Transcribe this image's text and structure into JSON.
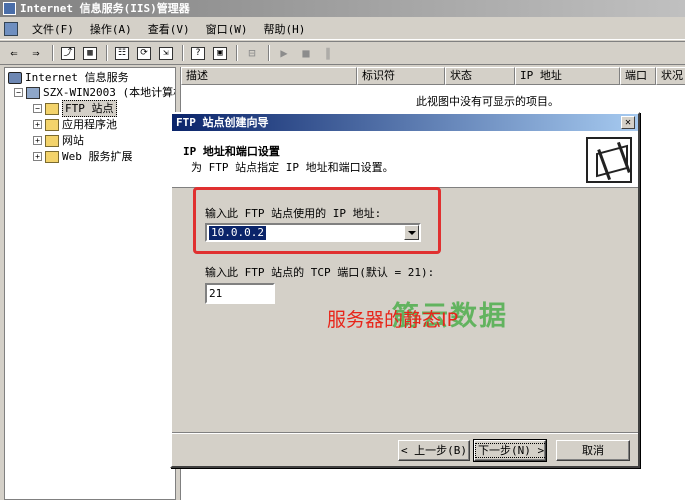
{
  "window": {
    "title": "Internet 信息服务(IIS)管理器"
  },
  "menu": [
    "文件(F)",
    "操作(A)",
    "查看(V)",
    "窗口(W)",
    "帮助(H)"
  ],
  "toolbar": {
    "icons": [
      "back-arrow-icon",
      "forward-arrow-icon",
      "up-folder-icon",
      "show-tree-icon",
      "properties-icon",
      "refresh-icon",
      "export-icon",
      "help-icon",
      "console-icon",
      "computer-icon",
      "play-icon",
      "stop-icon",
      "pause-icon"
    ],
    "glyphs": {
      "back": "⇐",
      "forward": "⇒",
      "up": "⤴",
      "tree": "▦",
      "props": "☷",
      "refresh": "⟳",
      "export": "⇲",
      "help": "?",
      "console": "▣",
      "computer": "⊟",
      "play": "▶",
      "stop": "■",
      "pause": "∥"
    }
  },
  "tree": {
    "root": "Internet 信息服务",
    "server": "SZX-WIN2003 (本地计算机)",
    "children": [
      "FTP 站点",
      "应用程序池",
      "网站",
      "Web 服务扩展"
    ]
  },
  "list": {
    "columns": [
      "描述",
      "标识符",
      "状态",
      "IP 地址",
      "端口",
      "状况"
    ],
    "empty_message": "此视图中没有可显示的项目。"
  },
  "dialog": {
    "title": "FTP 站点创建向导",
    "header_title": "IP 地址和端口设置",
    "header_subtitle": "为 FTP 站点指定 IP 地址和端口设置。",
    "ip_label": "输入此 FTP 站点使用的 IP 地址:",
    "ip_value": "10.0.0.2",
    "port_label": "输入此 FTP 站点的 TCP 端口(默认 = 21):",
    "port_value": "21",
    "back_button": "< 上一步(B)",
    "next_button": "下一步(N) >",
    "cancel_button": "取消",
    "close_glyph": "✕"
  },
  "annotation": {
    "text": "服务器的静态IP",
    "color": "#e8251a"
  },
  "watermark": {
    "text": "筋云数据",
    "color": "#3caa3c"
  },
  "colors": {
    "highlight_box": "#e03030",
    "dialog_titlebar": "#0a246a"
  }
}
